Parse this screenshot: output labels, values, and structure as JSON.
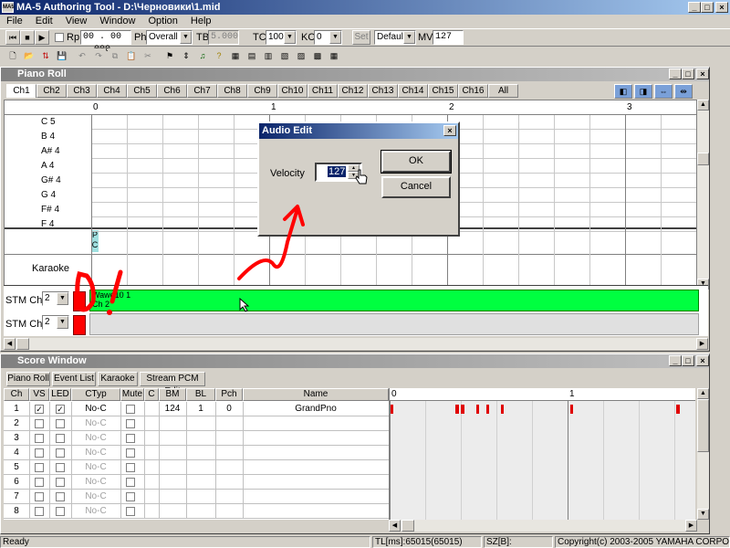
{
  "window": {
    "title": "MA-5 Authoring Tool - D:\\Черновики\\1.mid",
    "min": "_",
    "max": "□",
    "close": "×"
  },
  "menu": [
    "File",
    "Edit",
    "View",
    "Window",
    "Option",
    "Help"
  ],
  "transport": {
    "rp_label": "Rp",
    "time": "00 . 00 . 000",
    "ph_label": "Ph",
    "ph_value": "Overall",
    "tb_label": "TB",
    "tb_value": "5.000",
    "tc_label": "TC",
    "tc_value": "100",
    "kc_label": "KC",
    "kc_value": "0",
    "set_label": "Set",
    "default_value": "Default",
    "mv_label": "MV",
    "mv_value": "127"
  },
  "piano_roll": {
    "title": "Piano Roll",
    "channel_tabs": [
      "Ch1",
      "Ch2",
      "Ch3",
      "Ch4",
      "Ch5",
      "Ch6",
      "Ch7",
      "Ch8",
      "Ch9",
      "Ch10",
      "Ch11",
      "Ch12",
      "Ch13",
      "Ch14",
      "Ch15",
      "Ch16",
      "All"
    ],
    "measures": [
      "0",
      "1",
      "2",
      "3"
    ],
    "notes": [
      "C 5",
      "B 4",
      "A# 4",
      "A 4",
      "G# 4",
      "G 4",
      "F# 4",
      "F 4"
    ],
    "pc_marker": "P\nC",
    "karaoke_label": "Karaoke",
    "stm_ch1_label": "STM Ch1",
    "stm_ch1_value": "2",
    "stm_ch2_label": "STM Ch2",
    "stm_ch2_value": "2",
    "stream_block_text": "Wawe10 1\nCh 2"
  },
  "dialog": {
    "title": "Audio Edit",
    "velocity_label": "Velocity",
    "velocity_value": "127",
    "ok": "OK",
    "cancel": "Cancel"
  },
  "score_window": {
    "title": "Score Window",
    "tabs": [
      "Piano Roll",
      "Event List",
      "Karaoke",
      "Stream PCM Edit"
    ],
    "columns": [
      "Ch",
      "VS",
      "LED",
      "CTyp",
      "Mute",
      "C",
      "BM",
      "BL",
      "Pch",
      "Name"
    ],
    "rows": [
      {
        "ch": "1",
        "vs": true,
        "led": true,
        "ctyp": "No-C",
        "bm": "124",
        "bl": "1",
        "pch": "0",
        "name": "GrandPno"
      },
      {
        "ch": "2",
        "vs": false,
        "led": false,
        "ctyp": "No-C",
        "bm": "",
        "bl": "",
        "pch": "",
        "name": ""
      },
      {
        "ch": "3",
        "vs": false,
        "led": false,
        "ctyp": "No-C",
        "bm": "",
        "bl": "",
        "pch": "",
        "name": ""
      },
      {
        "ch": "4",
        "vs": false,
        "led": false,
        "ctyp": "No-C",
        "bm": "",
        "bl": "",
        "pch": "",
        "name": ""
      },
      {
        "ch": "5",
        "vs": false,
        "led": false,
        "ctyp": "No-C",
        "bm": "",
        "bl": "",
        "pch": "",
        "name": ""
      },
      {
        "ch": "6",
        "vs": false,
        "led": false,
        "ctyp": "No-C",
        "bm": "",
        "bl": "",
        "pch": "",
        "name": ""
      },
      {
        "ch": "7",
        "vs": false,
        "led": false,
        "ctyp": "No-C",
        "bm": "",
        "bl": "",
        "pch": "",
        "name": ""
      },
      {
        "ch": "8",
        "vs": false,
        "led": false,
        "ctyp": "No-C",
        "bm": "",
        "bl": "",
        "pch": "",
        "name": ""
      }
    ],
    "measures": [
      "0",
      "1"
    ]
  },
  "status": {
    "ready": "Ready",
    "tl": "TL[ms]:65015(65015)",
    "sz": "SZ[B]:",
    "copyright": "Copyright(c) 2003-2005 YAMAHA CORPORATION"
  },
  "colors": {
    "stream_green": "#00ff40",
    "note_red": "#e00000",
    "annotation_red": "#ff0000",
    "title_blue": "#0a246a"
  }
}
